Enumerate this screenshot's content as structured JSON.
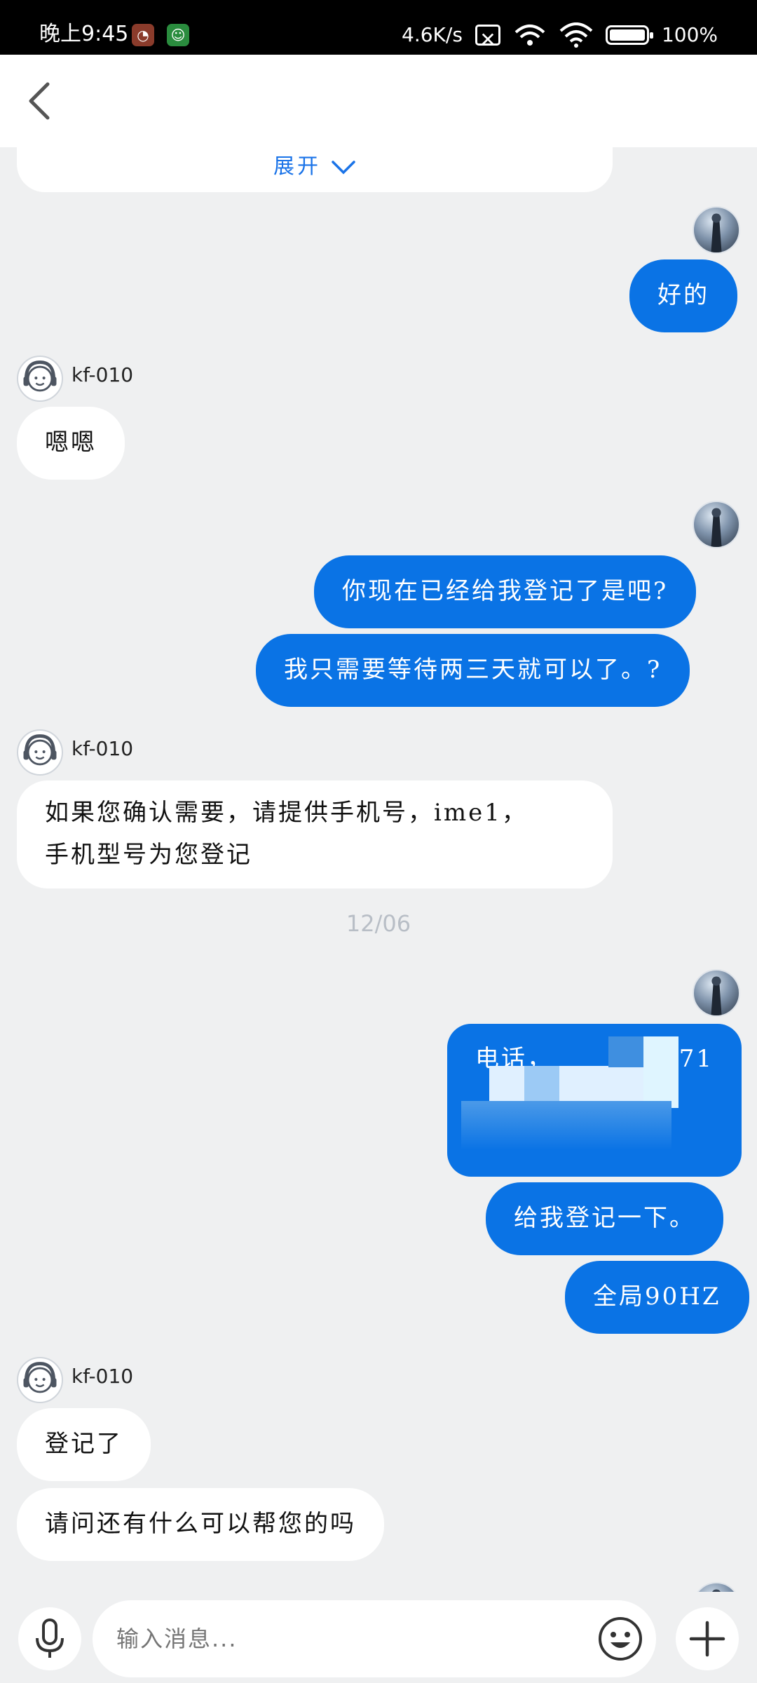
{
  "status_bar": {
    "time": "晚上9:45",
    "net_speed": "4.6K/s",
    "battery": "100%"
  },
  "chat": {
    "expand_label": "展开",
    "agent_name": "kf-010",
    "messages": [
      {
        "from": "me",
        "text": "好的"
      },
      {
        "from": "agent",
        "text": "嗯嗯"
      },
      {
        "from": "me",
        "text": "你现在已经给我登记了是吧?"
      },
      {
        "from": "me",
        "text": "我只需要等待两三天就可以了。?"
      },
      {
        "from": "agent",
        "text_line1": "如果您确认需要，请提供手机号，ime1，",
        "text_line2": "手机型号为您登记"
      },
      {
        "from": "me",
        "text_visible": "电话，",
        "text_tail": "71"
      },
      {
        "from": "me",
        "text": "给我登记一下。"
      },
      {
        "from": "me",
        "text": "全局90HZ"
      },
      {
        "from": "agent",
        "text": "登记了"
      },
      {
        "from": "agent",
        "text": "请问还有什么可以帮您的吗"
      }
    ],
    "date_separator": "12/06"
  },
  "input": {
    "placeholder": "输入消息..."
  },
  "colors": {
    "my_bubble": "#0a73e5",
    "background": "#eff0f1"
  }
}
